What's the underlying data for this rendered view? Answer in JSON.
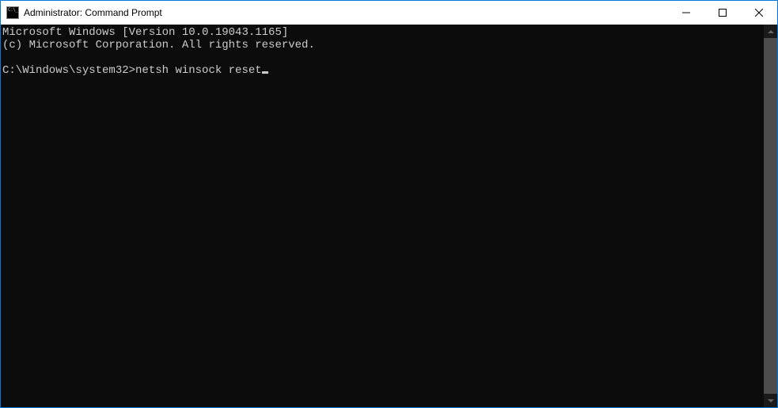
{
  "window": {
    "title": "Administrator: Command Prompt"
  },
  "terminal": {
    "banner_line1": "Microsoft Windows [Version 10.0.19043.1165]",
    "banner_line2": "(c) Microsoft Corporation. All rights reserved.",
    "prompt": "C:\\Windows\\system32>",
    "command": "netsh winsock reset"
  },
  "icons": {
    "minimize": "minimize-icon",
    "maximize": "maximize-icon",
    "close": "close-icon",
    "scroll_up": "chevron-up-icon",
    "scroll_down": "chevron-down-icon",
    "app": "cmd-icon"
  }
}
